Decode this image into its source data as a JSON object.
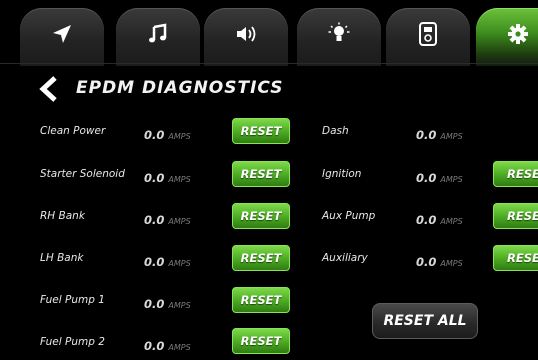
{
  "tabs": [
    {
      "name": "navigation-icon"
    },
    {
      "name": "music-icon"
    },
    {
      "name": "volume-icon"
    },
    {
      "name": "light-bulb-icon"
    },
    {
      "name": "device-icon"
    },
    {
      "name": "gear-icon",
      "active": true
    }
  ],
  "header": {
    "title": "EPDM DIAGNOSTICS"
  },
  "left_channels": [
    {
      "label": "Clean Power",
      "value": "0.0",
      "unit": "AMPS",
      "button": "RESET"
    },
    {
      "label": "Starter Solenoid",
      "value": "0.0",
      "unit": "AMPS",
      "button": "RESET"
    },
    {
      "label": "RH Bank",
      "value": "0.0",
      "unit": "AMPS",
      "button": "RESET"
    },
    {
      "label": "LH Bank",
      "value": "0.0",
      "unit": "AMPS",
      "button": "RESET"
    },
    {
      "label": "Fuel Pump 1",
      "value": "0.0",
      "unit": "AMPS",
      "button": "RESET"
    },
    {
      "label": "Fuel Pump 2",
      "value": "0.0",
      "unit": "AMPS",
      "button": "RESET"
    }
  ],
  "right_channels": [
    {
      "label": "Dash",
      "value": "0.0",
      "unit": "AMPS"
    },
    {
      "label": "Ignition",
      "value": "0.0",
      "unit": "AMPS",
      "button": "RESE"
    },
    {
      "label": "Aux Pump",
      "value": "0.0",
      "unit": "AMPS",
      "button": "RESE"
    },
    {
      "label": "Auxiliary",
      "value": "0.0",
      "unit": "AMPS",
      "button": "RESE"
    }
  ],
  "reset_all_label": "RESET ALL",
  "colors": {
    "accent_green": "#4fae24",
    "background": "#000000"
  }
}
